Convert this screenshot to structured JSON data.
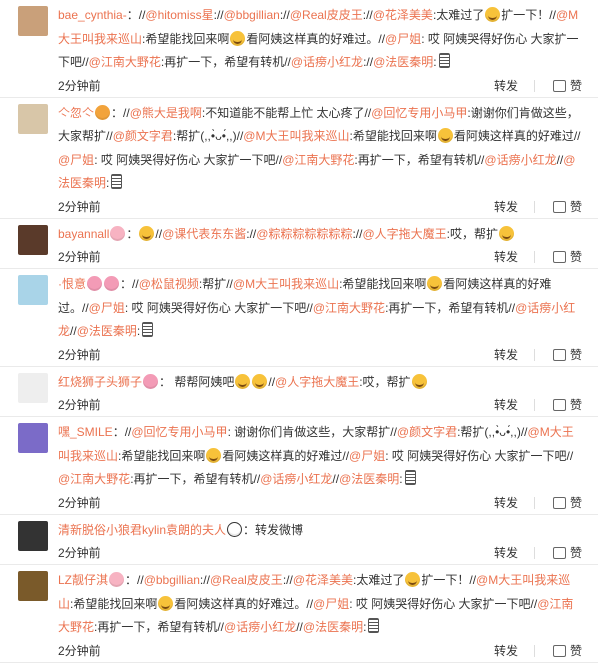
{
  "comments": [
    {
      "user": "bae_cynthia-",
      "avatar_color": "#c9a07a",
      "segments": [
        {
          "t": "u",
          "v": "bae_cynthia-"
        },
        {
          "t": "s",
          "v": "："
        },
        {
          "t": "s",
          "v": "//"
        },
        {
          "t": "l",
          "v": "@hitomiss星"
        },
        {
          "t": "s",
          "v": "://"
        },
        {
          "t": "l",
          "v": "@bbgillian"
        },
        {
          "t": "s",
          "v": "://"
        },
        {
          "t": "l",
          "v": "@Real皮皮王"
        },
        {
          "t": "s",
          "v": "://"
        },
        {
          "t": "l",
          "v": "@花泽美美"
        },
        {
          "t": "s",
          "v": ":太难过了"
        },
        {
          "t": "e",
          "v": "cry"
        },
        {
          "t": "s",
          "v": "扩一下！//"
        },
        {
          "t": "l",
          "v": "@M大王叫我来巡山"
        },
        {
          "t": "s",
          "v": ":希望能找回来啊"
        },
        {
          "t": "e",
          "v": "cry"
        },
        {
          "t": "s",
          "v": "看阿姨这样真的好难过。//"
        },
        {
          "t": "l",
          "v": "@尸姐"
        },
        {
          "t": "s",
          "v": ": 哎 阿姨哭得好伤心 大家扩一下吧//"
        },
        {
          "t": "l",
          "v": "@江南大野花"
        },
        {
          "t": "s",
          "v": ":再扩一下，希望有转机//"
        },
        {
          "t": "l",
          "v": "@话痨小红龙"
        },
        {
          "t": "s",
          "v": "://"
        },
        {
          "t": "l",
          "v": "@法医秦明"
        },
        {
          "t": "s",
          "v": ":"
        },
        {
          "t": "m",
          "v": "mic"
        }
      ],
      "time": "2分钟前"
    },
    {
      "user": "亽忽亽",
      "avatar_color": "#d8c6a8",
      "segments": [
        {
          "t": "u",
          "v": "亽忽亽"
        },
        {
          "t": "e",
          "v": "tea"
        },
        {
          "t": "s",
          "v": "："
        },
        {
          "t": "s",
          "v": "//"
        },
        {
          "t": "l",
          "v": "@熊大是我啊"
        },
        {
          "t": "s",
          "v": ":不知道能不能帮上忙 太心疼了//"
        },
        {
          "t": "l",
          "v": "@回忆专用小马甲"
        },
        {
          "t": "s",
          "v": ":谢谢你们肯做这些，大家帮扩"
        },
        {
          "t": "s",
          "v": "//"
        },
        {
          "t": "l",
          "v": "@颜文字君"
        },
        {
          "t": "s",
          "v": ":帮扩(,,•̀ᴗ•́,,)//"
        },
        {
          "t": "l",
          "v": "@M大王叫我来巡山"
        },
        {
          "t": "s",
          "v": ":希望能找回来啊"
        },
        {
          "t": "e",
          "v": "cry"
        },
        {
          "t": "s",
          "v": "看阿姨这样真的好难过//"
        },
        {
          "t": "l",
          "v": "@尸姐"
        },
        {
          "t": "s",
          "v": ": 哎 阿姨哭得好伤心 大家扩一下吧//"
        },
        {
          "t": "l",
          "v": "@江南大野花"
        },
        {
          "t": "s",
          "v": ":再扩一下，希望有转机//"
        },
        {
          "t": "l",
          "v": "@话痨小红龙"
        },
        {
          "t": "s",
          "v": "//"
        },
        {
          "t": "l",
          "v": "@法医秦明"
        },
        {
          "t": "s",
          "v": ":"
        },
        {
          "t": "m",
          "v": "mic"
        }
      ],
      "time": "2分钟前"
    },
    {
      "user": "bayannall",
      "avatar_color": "#5a3a2a",
      "segments": [
        {
          "t": "u",
          "v": "bayannall"
        },
        {
          "t": "e",
          "v": "pig"
        },
        {
          "t": "s",
          "v": "："
        },
        {
          "t": "e",
          "v": "cry"
        },
        {
          "t": "s",
          "v": "//"
        },
        {
          "t": "l",
          "v": "@课代表东东酱"
        },
        {
          "t": "s",
          "v": "://"
        },
        {
          "t": "l",
          "v": "@粽粽粽粽粽粽粽"
        },
        {
          "t": "s",
          "v": "://"
        },
        {
          "t": "l",
          "v": "@人字拖大魔王"
        },
        {
          "t": "s",
          "v": ":哎，帮扩"
        },
        {
          "t": "e",
          "v": "cry"
        }
      ],
      "time": "2分钟前"
    },
    {
      "user": "·恨意",
      "avatar_color": "#a9d4e8",
      "segments": [
        {
          "t": "u",
          "v": "·恨意"
        },
        {
          "t": "e",
          "v": "pink"
        },
        {
          "t": "e",
          "v": "pink"
        },
        {
          "t": "s",
          "v": "："
        },
        {
          "t": "s",
          "v": "//"
        },
        {
          "t": "l",
          "v": "@松鼠视频"
        },
        {
          "t": "s",
          "v": ":帮扩//"
        },
        {
          "t": "l",
          "v": "@M大王叫我来巡山"
        },
        {
          "t": "s",
          "v": ":希望能找回来啊"
        },
        {
          "t": "e",
          "v": "cry"
        },
        {
          "t": "s",
          "v": "看阿姨这样真的好难过。//"
        },
        {
          "t": "l",
          "v": "@尸姐"
        },
        {
          "t": "s",
          "v": ": 哎 阿姨哭得好伤心 大家扩一下吧//"
        },
        {
          "t": "l",
          "v": "@江南大野花"
        },
        {
          "t": "s",
          "v": ":再扩一下，希望有转机//"
        },
        {
          "t": "l",
          "v": "@话痨小红龙"
        },
        {
          "t": "s",
          "v": "//"
        },
        {
          "t": "l",
          "v": "@法医秦明"
        },
        {
          "t": "s",
          "v": ":"
        },
        {
          "t": "m",
          "v": "mic"
        }
      ],
      "time": "2分钟前"
    },
    {
      "user": "红烧狮子头狮子",
      "avatar_color": "#eeeeee",
      "segments": [
        {
          "t": "u",
          "v": "红烧狮子头狮子"
        },
        {
          "t": "e",
          "v": "pink"
        },
        {
          "t": "s",
          "v": "： 帮帮阿姨吧"
        },
        {
          "t": "e",
          "v": "cry"
        },
        {
          "t": "e",
          "v": "cry"
        },
        {
          "t": "s",
          "v": "//"
        },
        {
          "t": "l",
          "v": "@人字拖大魔王"
        },
        {
          "t": "s",
          "v": ":哎，帮扩"
        },
        {
          "t": "e",
          "v": "cry"
        }
      ],
      "time": "2分钟前"
    },
    {
      "user": "嘿_SMILE",
      "avatar_color": "#7b6bc8",
      "segments": [
        {
          "t": "u",
          "v": "嘿_SMILE"
        },
        {
          "t": "s",
          "v": "："
        },
        {
          "t": "s",
          "v": "//"
        },
        {
          "t": "l",
          "v": "@回忆专用小马甲"
        },
        {
          "t": "s",
          "v": ": 谢谢你们肯做这些，大家帮扩//"
        },
        {
          "t": "l",
          "v": "@颜文字君"
        },
        {
          "t": "s",
          "v": ":帮扩(,,•̀ᴗ•́,,)//"
        },
        {
          "t": "l",
          "v": "@M大王叫我来巡山"
        },
        {
          "t": "s",
          "v": ":希望能找回来啊"
        },
        {
          "t": "e",
          "v": "cry"
        },
        {
          "t": "s",
          "v": "看阿姨这样真的好难过//"
        },
        {
          "t": "l",
          "v": "@尸姐"
        },
        {
          "t": "s",
          "v": ": 哎 阿姨哭得好伤心 大家扩一下吧//"
        },
        {
          "t": "l",
          "v": "@江南大野花"
        },
        {
          "t": "s",
          "v": ":再扩一下，希望有转机//"
        },
        {
          "t": "l",
          "v": "@话痨小红龙"
        },
        {
          "t": "s",
          "v": "//"
        },
        {
          "t": "l",
          "v": "@法医秦明"
        },
        {
          "t": "s",
          "v": ":"
        },
        {
          "t": "m",
          "v": "mic"
        }
      ],
      "time": "2分钟前"
    },
    {
      "user": "清新脱俗小狼君kylin袁朗的夫人",
      "avatar_color": "#333333",
      "segments": [
        {
          "t": "u",
          "v": "清新脱俗小狼君kylin袁朗的夫人"
        },
        {
          "t": "e",
          "v": "panda"
        },
        {
          "t": "s",
          "v": "：转发微博"
        }
      ],
      "time": "2分钟前"
    },
    {
      "user": "LZ靓仔淇",
      "avatar_color": "#7a5a2a",
      "segments": [
        {
          "t": "u",
          "v": "LZ靓仔淇"
        },
        {
          "t": "e",
          "v": "pig"
        },
        {
          "t": "s",
          "v": "："
        },
        {
          "t": "s",
          "v": "//"
        },
        {
          "t": "l",
          "v": "@bbgillian"
        },
        {
          "t": "s",
          "v": "://"
        },
        {
          "t": "l",
          "v": "@Real皮皮王"
        },
        {
          "t": "s",
          "v": "://"
        },
        {
          "t": "l",
          "v": "@花泽美美"
        },
        {
          "t": "s",
          "v": ":太难过了"
        },
        {
          "t": "e",
          "v": "cry"
        },
        {
          "t": "s",
          "v": "扩一下！//"
        },
        {
          "t": "l",
          "v": "@M大王叫我来巡山"
        },
        {
          "t": "s",
          "v": ":希望能找回来啊"
        },
        {
          "t": "e",
          "v": "cry"
        },
        {
          "t": "s",
          "v": "看阿姨这样真的好难过。//"
        },
        {
          "t": "l",
          "v": "@尸姐"
        },
        {
          "t": "s",
          "v": ": 哎 阿姨哭得好伤心 大家扩一下吧//"
        },
        {
          "t": "l",
          "v": "@江南大野花"
        },
        {
          "t": "s",
          "v": ":再扩一下，希望有转机//"
        },
        {
          "t": "l",
          "v": "@话痨小红龙"
        },
        {
          "t": "s",
          "v": "//"
        },
        {
          "t": "l",
          "v": "@法医秦明"
        },
        {
          "t": "s",
          "v": ":"
        },
        {
          "t": "m",
          "v": "mic"
        }
      ],
      "time": "2分钟前"
    }
  ],
  "actions": {
    "repost_label": "转发",
    "like_label": "赞"
  },
  "colors": {
    "accent": "#eb7350",
    "text": "#333333"
  }
}
